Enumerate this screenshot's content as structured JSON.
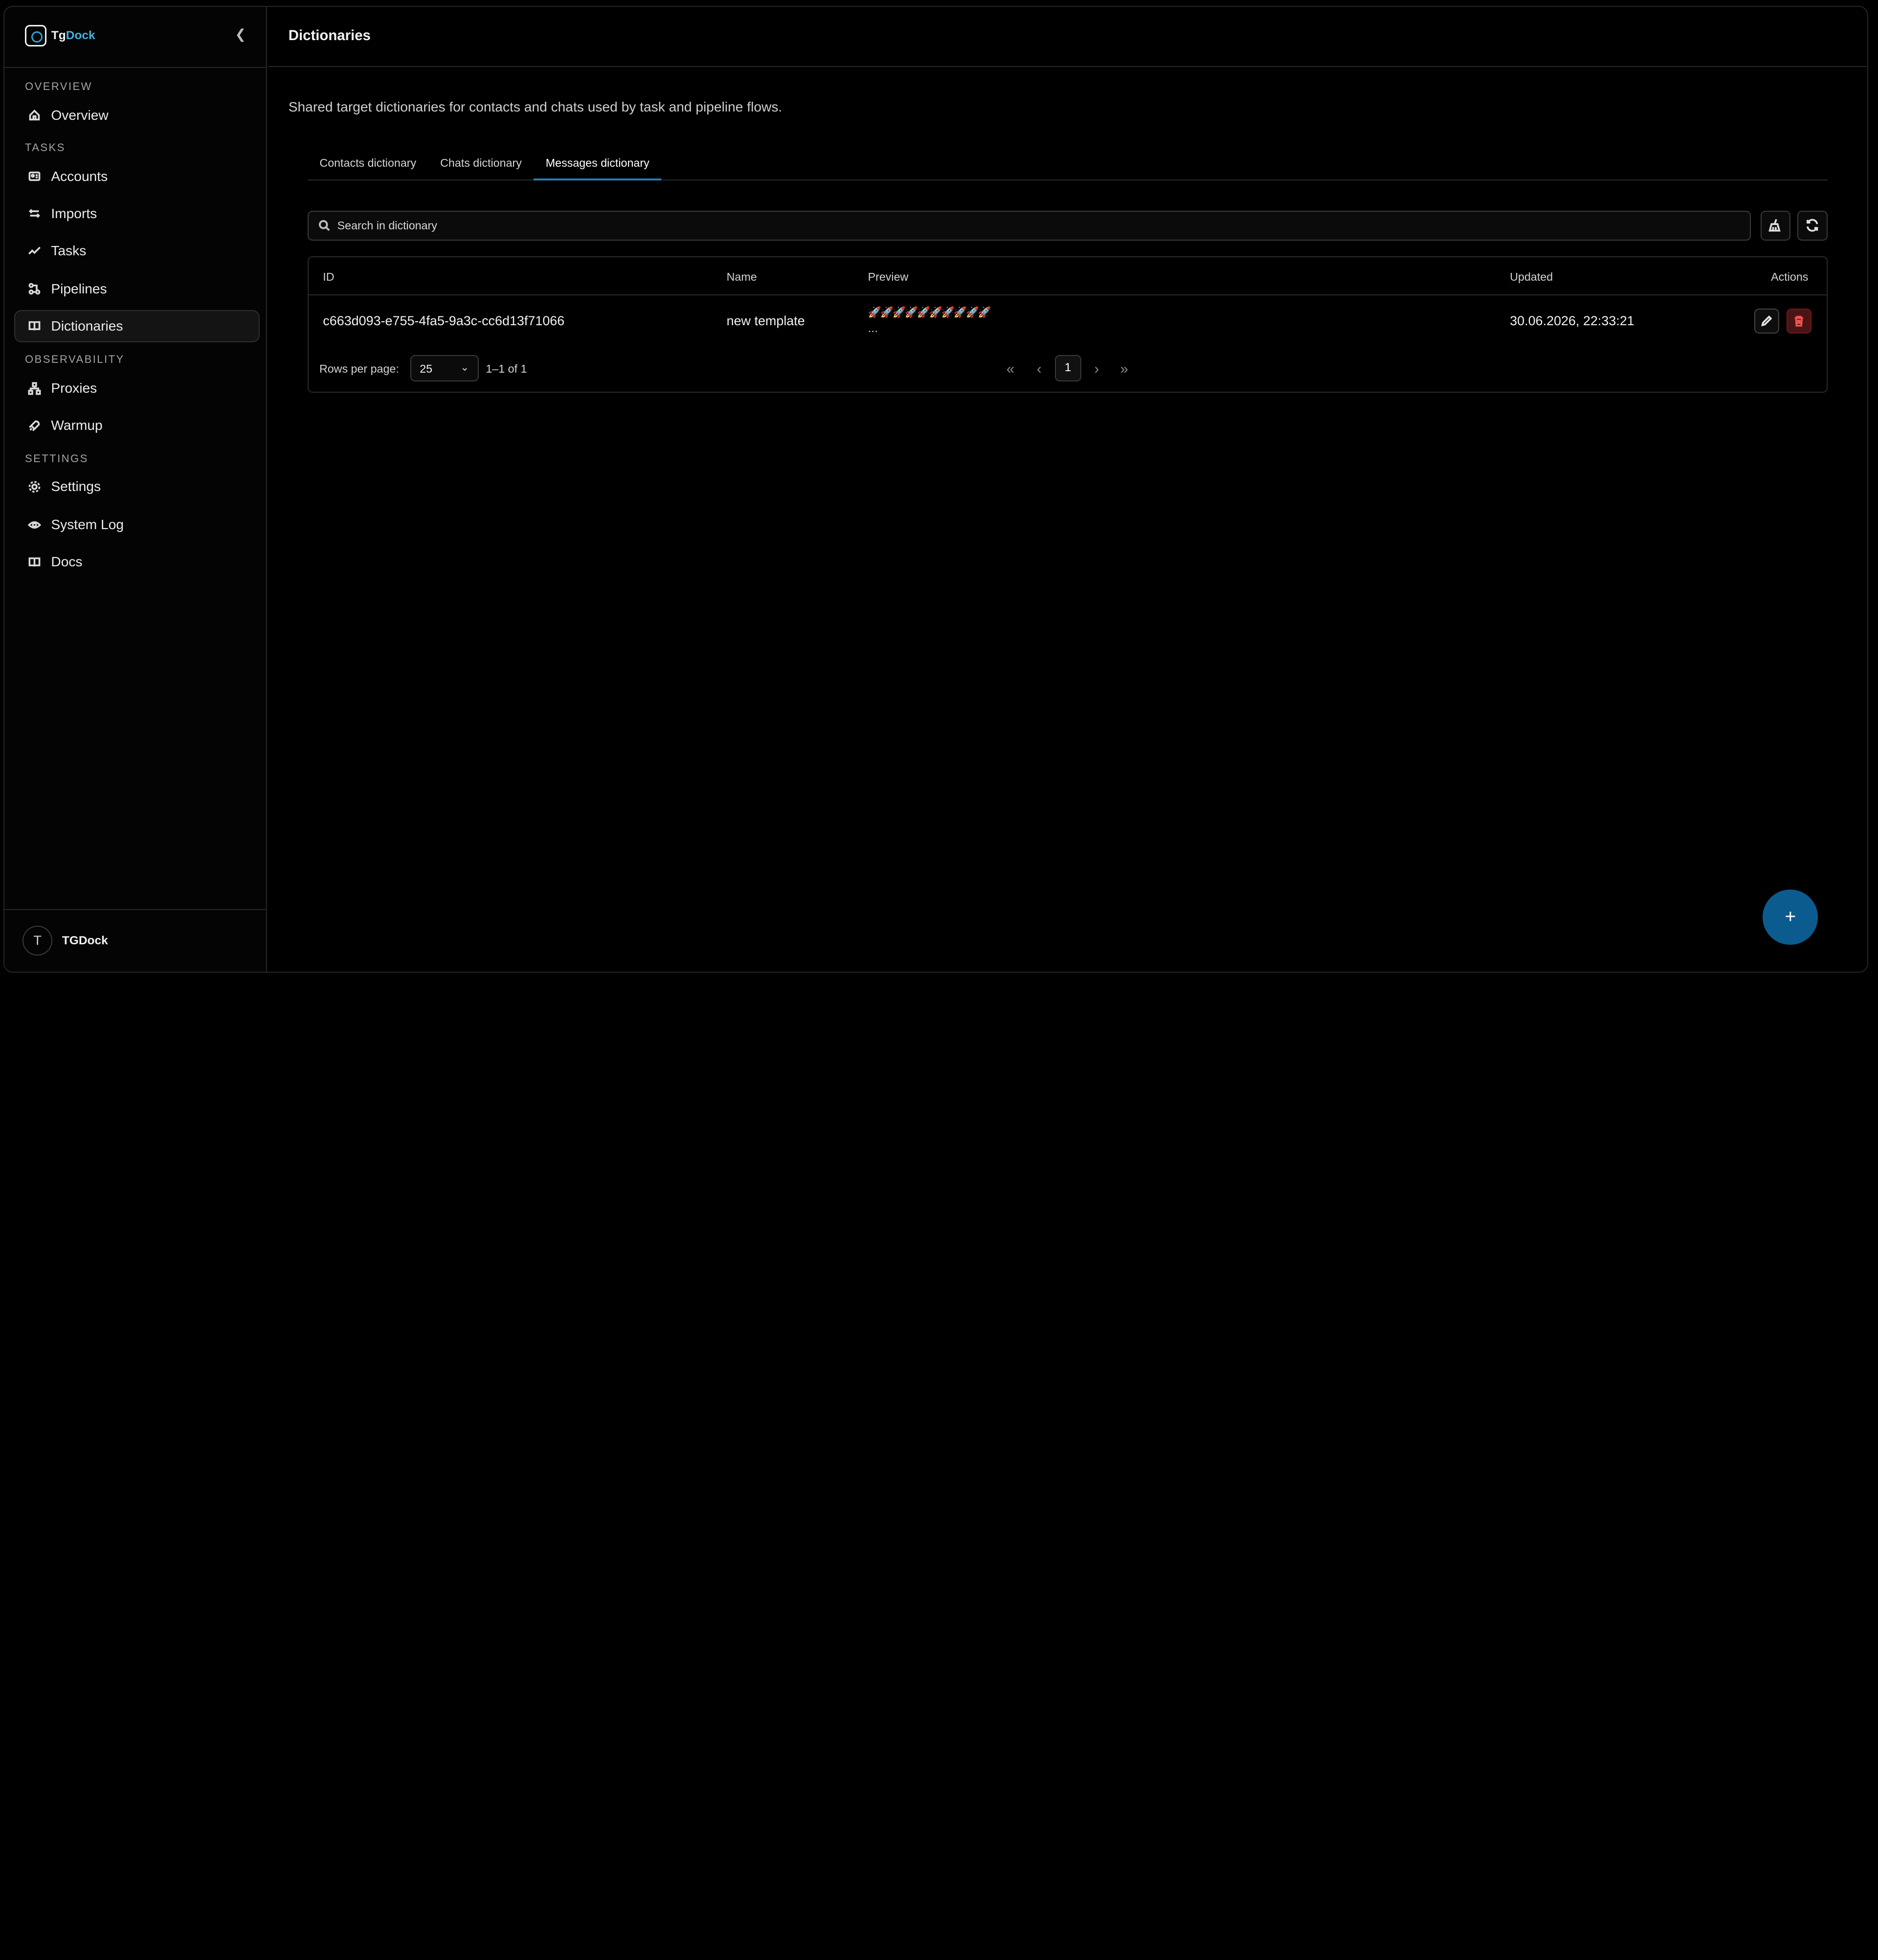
{
  "brand": {
    "name_part1": "Tg",
    "name_part2": "Dock"
  },
  "sidebar": {
    "sections": [
      {
        "label": "OVERVIEW"
      },
      {
        "label": "TASKS"
      },
      {
        "label": "OBSERVABILITY"
      },
      {
        "label": "SETTINGS"
      }
    ],
    "items": [
      {
        "label": "Overview",
        "icon": "home-icon"
      },
      {
        "label": "Accounts",
        "icon": "id-card-icon"
      },
      {
        "label": "Imports",
        "icon": "arrows-icon"
      },
      {
        "label": "Tasks",
        "icon": "activity-icon"
      },
      {
        "label": "Pipelines",
        "icon": "workflow-icon"
      },
      {
        "label": "Dictionaries",
        "icon": "book-icon",
        "active": true
      },
      {
        "label": "Proxies",
        "icon": "network-icon"
      },
      {
        "label": "Warmup",
        "icon": "rocket-icon"
      },
      {
        "label": "Settings",
        "icon": "gear-icon"
      },
      {
        "label": "System Log",
        "icon": "eye-icon"
      },
      {
        "label": "Docs",
        "icon": "book-open-icon"
      }
    ]
  },
  "user": {
    "initial": "T",
    "name": "TGDock"
  },
  "header": {
    "title": "Dictionaries"
  },
  "main": {
    "description": "Shared target dictionaries for contacts and chats used by task and pipeline flows.",
    "tabs": [
      {
        "label": "Contacts dictionary"
      },
      {
        "label": "Chats dictionary"
      },
      {
        "label": "Messages dictionary",
        "active": true
      }
    ],
    "search": {
      "placeholder": "Search in dictionary",
      "value": ""
    },
    "table": {
      "columns": [
        "ID",
        "Name",
        "Preview",
        "Updated",
        "Actions"
      ],
      "rows": [
        {
          "id": "c663d093-e755-4fa5-9a3c-cc6d13f71066",
          "name": "new template",
          "preview": "🚀🚀🚀🚀🚀🚀🚀🚀🚀🚀",
          "preview_more": "...",
          "updated": "30.06.2026, 22:33:21"
        }
      ]
    },
    "pagination": {
      "rows_per_page_label": "Rows per page:",
      "rows_per_page": "25",
      "range": "1–1 of 1",
      "current_page": "1"
    }
  },
  "fab": {
    "label": "+"
  },
  "colors": {
    "accent": "#2a7cb5",
    "fab": "#0b5b8f",
    "danger": "#f05252"
  }
}
